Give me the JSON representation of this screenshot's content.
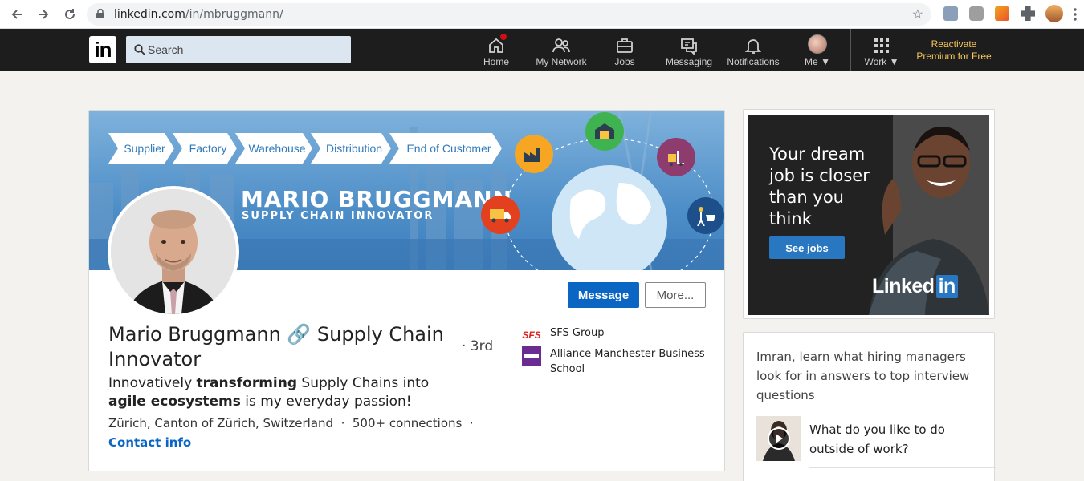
{
  "browser": {
    "url_host": "linkedin.com",
    "url_path": "/in/mbruggmann/"
  },
  "nav": {
    "logo": "in",
    "search_placeholder": "Search",
    "items": [
      {
        "label": "Home",
        "icon": "home-icon"
      },
      {
        "label": "My Network",
        "icon": "network-icon"
      },
      {
        "label": "Jobs",
        "icon": "briefcase-icon"
      },
      {
        "label": "Messaging",
        "icon": "messaging-icon"
      },
      {
        "label": "Notifications",
        "icon": "bell-icon"
      },
      {
        "label": "Me",
        "icon": "avatar"
      },
      {
        "label": "Work",
        "icon": "grid-icon"
      }
    ],
    "premium_line1": "Reactivate",
    "premium_line2": "Premium for Free"
  },
  "banner": {
    "steps": [
      "Supplier",
      "Factory",
      "Warehouse",
      "Distribution",
      "End of Customer"
    ],
    "name": "MARIO BRUGGMANN",
    "subtitle": "SUPPLY CHAIN INNOVATOR"
  },
  "profile": {
    "name": "Mario Bruggmann 🔗 Supply Chain Innovator",
    "degree": "· 3rd",
    "headline_parts": [
      "Innovatively ",
      "transforming",
      " Supply Chains into ",
      "agile ecosystems",
      " is my everyday passion!"
    ],
    "location": "Zürich, Canton of Zürich, Switzerland",
    "connections": "500+ connections",
    "contact": "Contact info",
    "message_button": "Message",
    "more_button": "More...",
    "orgs": [
      {
        "name": "SFS Group",
        "logo": "SFS"
      },
      {
        "name": "Alliance Manchester Business School",
        "logo": ""
      }
    ]
  },
  "ad": {
    "text": "Your dream job is closer than you think",
    "button": "See jobs",
    "brand": "Linked",
    "brand_in": "in"
  },
  "interview": {
    "prompt": "Imran, learn what hiring managers look for in answers to top interview questions",
    "question": "What do you like to do outside of work?"
  },
  "colors": {
    "linkedin_blue": "#0a66c2",
    "nav_bg": "#1d1d1d",
    "premium_gold": "#f5c75d"
  }
}
